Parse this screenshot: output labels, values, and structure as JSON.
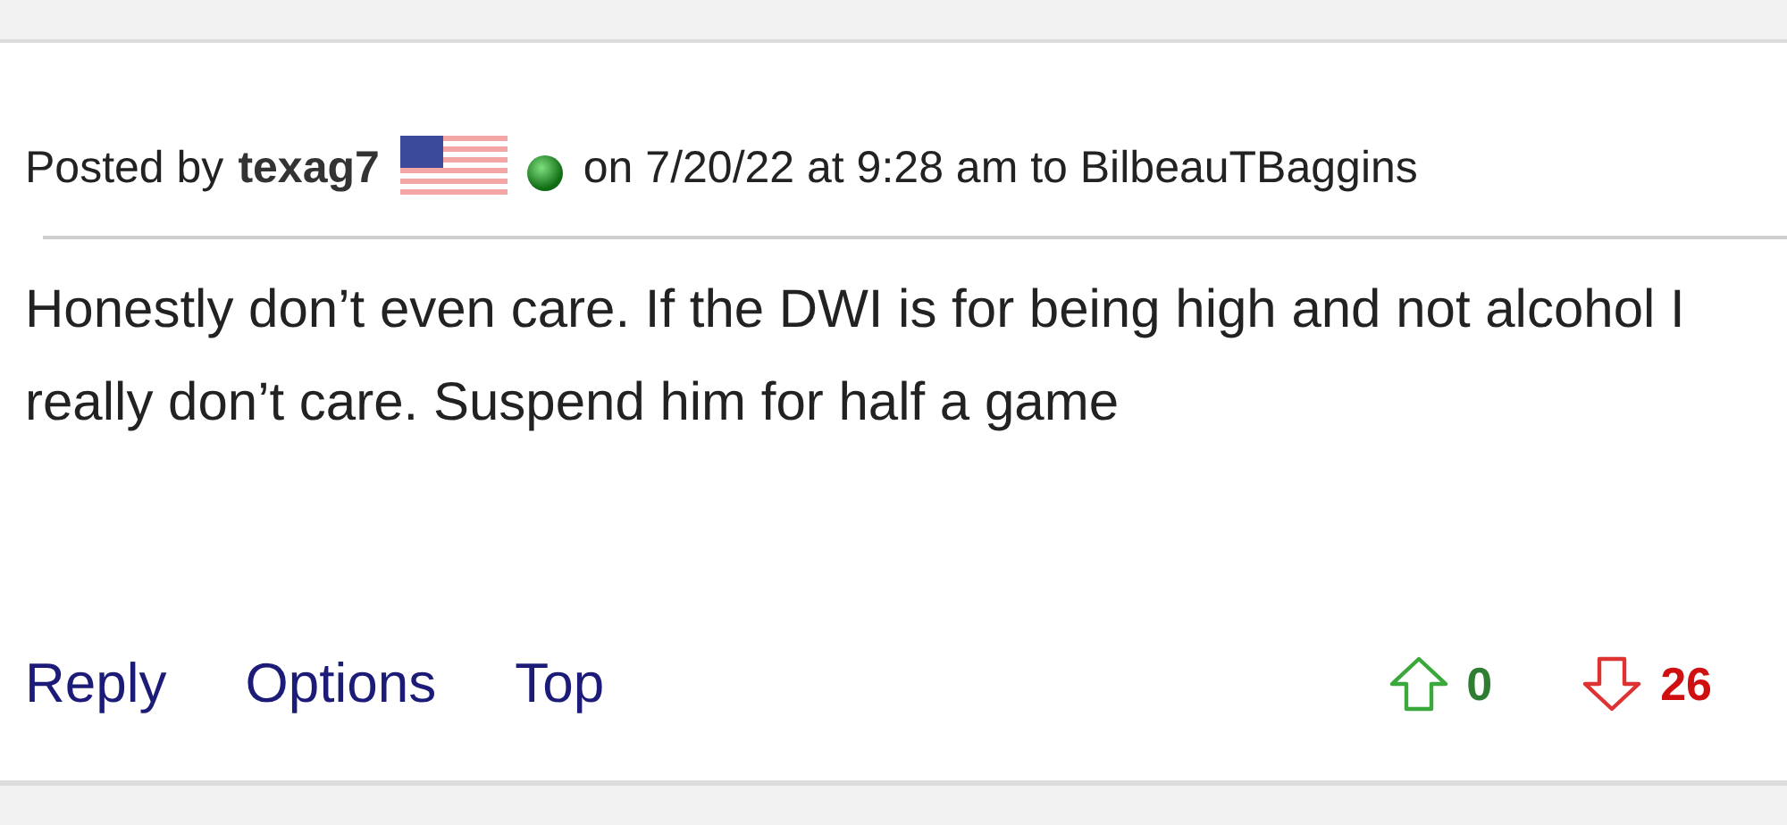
{
  "post": {
    "prefix": "Posted by",
    "author": "texag7",
    "online": true,
    "meta": "on 7/20/22 at 9:28 am to BilbeauTBaggins",
    "body": "Honestly don’t even care. If the DWI is for being high and not alcohol I really don’t care. Suspend him for half a game",
    "actions": [
      "Reply",
      "Options",
      "Top"
    ],
    "upvotes": "0",
    "downvotes": "26"
  }
}
